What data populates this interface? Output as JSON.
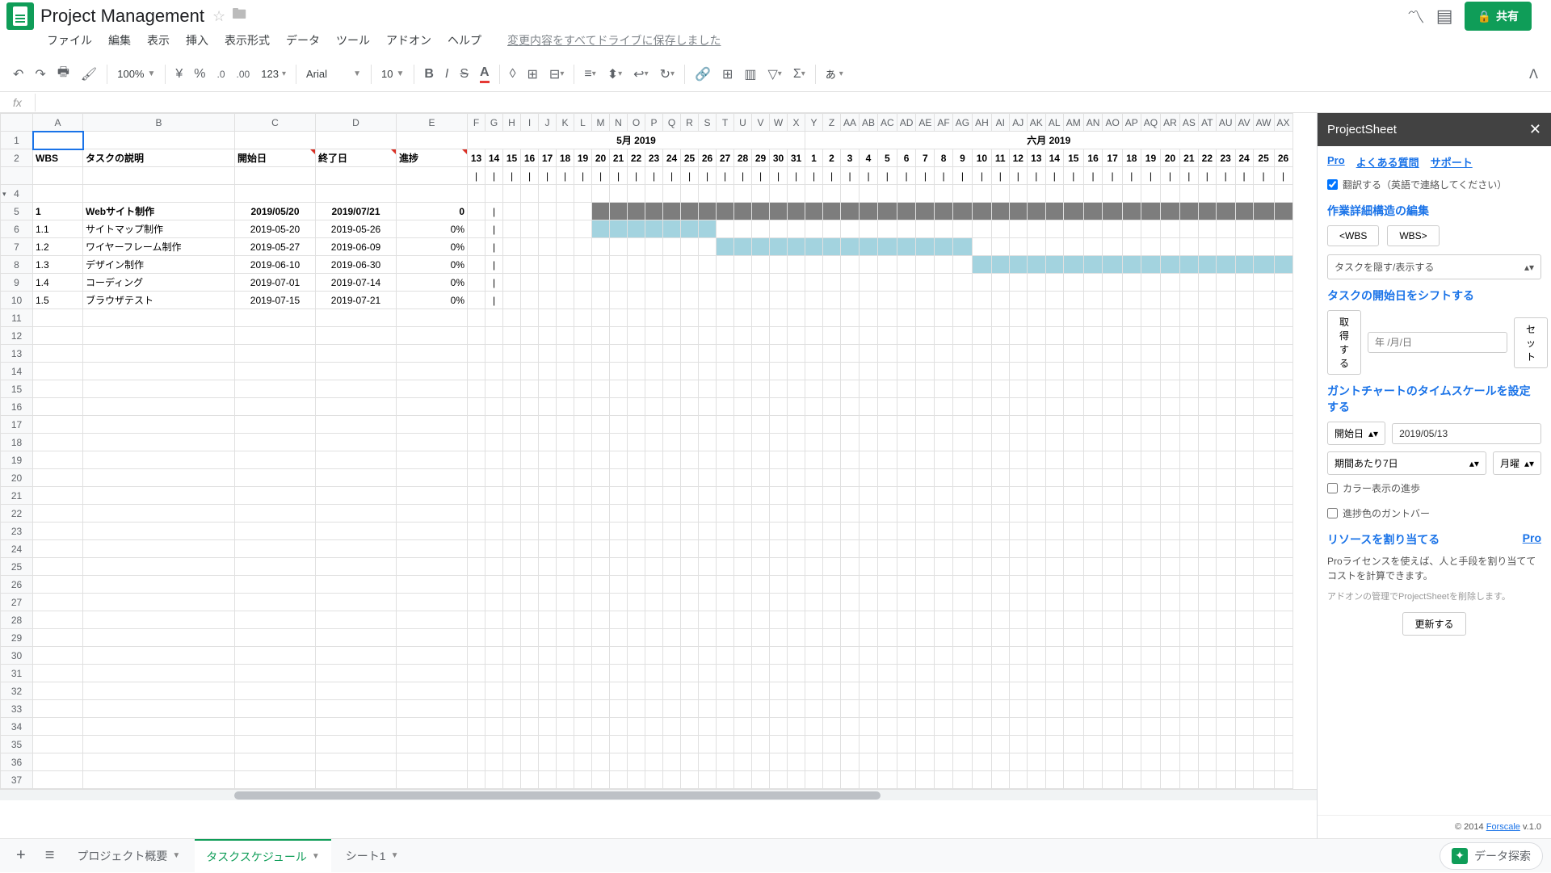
{
  "title": "Project Management",
  "menus": [
    "ファイル",
    "編集",
    "表示",
    "挿入",
    "表示形式",
    "データ",
    "ツール",
    "アドオン",
    "ヘルプ"
  ],
  "save_msg": "変更内容をすべてドライブに保存しました",
  "share_label": "共有",
  "zoom": "100%",
  "font": "Arial",
  "font_size": "10",
  "currency": "¥",
  "percent": "%",
  "dec_less": ".0",
  "dec_more": ".00",
  "num_fmt": "123",
  "ime": "あ",
  "fx": "fx",
  "columns": [
    "A",
    "B",
    "C",
    "D",
    "E",
    "F",
    "G",
    "H",
    "I",
    "J",
    "K",
    "L",
    "M",
    "N",
    "O",
    "P",
    "Q",
    "R",
    "S",
    "T",
    "U",
    "V",
    "W",
    "X",
    "Y",
    "Z",
    "AA",
    "AB",
    "AC",
    "AD",
    "AE",
    "AF",
    "AG",
    "AH",
    "AI",
    "AJ",
    "AK",
    "AL",
    "AM",
    "AN",
    "AO",
    "AP",
    "AQ",
    "AR",
    "AS",
    "AT",
    "AU",
    "AV",
    "AW",
    "AX"
  ],
  "hdr": {
    "wbs": "WBS",
    "desc": "タスクの説明",
    "start": "開始日",
    "end": "終了日",
    "progress": "進捗"
  },
  "months": {
    "may": "5月 2019",
    "june": "六月 2019"
  },
  "days": [
    "13",
    "14",
    "15",
    "16",
    "17",
    "18",
    "19",
    "20",
    "21",
    "22",
    "23",
    "24",
    "25",
    "26",
    "27",
    "28",
    "29",
    "30",
    "31",
    "1",
    "2",
    "3",
    "4",
    "5",
    "6",
    "7",
    "8",
    "9",
    "10",
    "11",
    "12",
    "13",
    "14",
    "15",
    "16",
    "17",
    "18",
    "19",
    "20",
    "21",
    "22",
    "23",
    "24",
    "25",
    "26"
  ],
  "tasks": [
    {
      "wbs": "1",
      "desc": "Webサイト制作",
      "start": "2019/05/20",
      "end": "2019/07/21",
      "prog": "0",
      "bold": true,
      "bar": "gray",
      "from": 7,
      "to": 45
    },
    {
      "wbs": "1.1",
      "desc": "サイトマップ制作",
      "start": "2019-05-20",
      "end": "2019-05-26",
      "prog": "0%",
      "bar": "blue",
      "from": 7,
      "to": 14
    },
    {
      "wbs": "1.2",
      "desc": "ワイヤーフレーム制作",
      "start": "2019-05-27",
      "end": "2019-06-09",
      "prog": "0%",
      "bar": "blue",
      "from": 14,
      "to": 28
    },
    {
      "wbs": "1.3",
      "desc": "デザイン制作",
      "start": "2019-06-10",
      "end": "2019-06-30",
      "prog": "0%",
      "bar": "blue",
      "from": 28,
      "to": 45
    },
    {
      "wbs": "1.4",
      "desc": "コーディング",
      "start": "2019-07-01",
      "end": "2019-07-14",
      "prog": "0%"
    },
    {
      "wbs": "1.5",
      "desc": "ブラウザテスト",
      "start": "2019-07-15",
      "end": "2019-07-21",
      "prog": "0%"
    }
  ],
  "sidebar": {
    "title": "ProjectSheet",
    "pro": "Pro",
    "faq": "よくある質問",
    "support": "サポート",
    "translate": "翻訳する（英語で連絡してください）",
    "sec_wbs": "作業詳細構造の編集",
    "wbs_in": "<WBS",
    "wbs_out": "WBS>",
    "hide_task": "タスクを隠す/表示する",
    "sec_shift": "タスクの開始日をシフトする",
    "get": "取得する",
    "date_ph": "年 /月/日",
    "set": "セット",
    "sec_scale": "ガントチャートのタイムスケールを設定する",
    "scale_mode": "開始日",
    "scale_date": "2019/05/13",
    "period": "期間あたり7日",
    "weekday": "月曜",
    "color_progress": "カラー表示の進歩",
    "progress_bar": "進捗色のガントバー",
    "sec_resource": "リソースを割り当てる",
    "resource_text": "Proライセンスを使えば、人と手段を割り当ててコストを計算できます。",
    "remove_text": "アドオンの管理でProjectSheetを削除します。",
    "refresh": "更新する",
    "copyright": "© 2014",
    "brand": "Forscale",
    "version": "v.1.0"
  },
  "tabs": {
    "t1": "プロジェクト概要",
    "t2": "タスクスケジュール",
    "t3": "シート1"
  },
  "explore": "データ探索",
  "bar_char": "|"
}
